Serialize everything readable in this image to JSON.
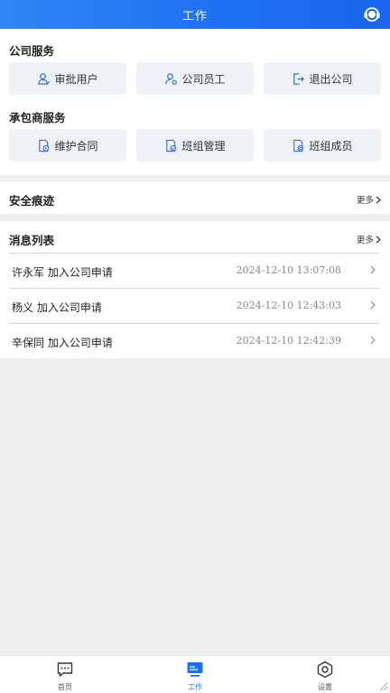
{
  "header": {
    "title": "工作",
    "icon": "headset-icon"
  },
  "company_services": {
    "title": "公司服务",
    "buttons": [
      {
        "label": "审批用户",
        "icon": "user-approve-icon"
      },
      {
        "label": "公司员工",
        "icon": "employee-settings-icon"
      },
      {
        "label": "退出公司",
        "icon": "logout-icon"
      }
    ]
  },
  "contractor_services": {
    "title": "承包商服务",
    "buttons": [
      {
        "label": "维护合同",
        "icon": "contract-doc-icon"
      },
      {
        "label": "班组管理",
        "icon": "doc-check-icon"
      },
      {
        "label": "班组成员",
        "icon": "doc-gear-icon"
      }
    ]
  },
  "safety": {
    "title": "安全痕迹",
    "more_label": "更多"
  },
  "messages": {
    "title": "消息列表",
    "more_label": "更多",
    "items": [
      {
        "text": "许永军 加入公司申请",
        "time": "2024-12-10 13:07:08"
      },
      {
        "text": "杨义 加入公司申请",
        "time": "2024-12-10 12:43:03"
      },
      {
        "text": "辛保同 加入公司申请",
        "time": "2024-12-10 12:42:39"
      }
    ]
  },
  "tabbar": {
    "active": "工作",
    "tabs": [
      {
        "label": "首页",
        "icon": "chat-icon"
      },
      {
        "label": "工作",
        "icon": "monitor-icon"
      },
      {
        "label": "设置",
        "icon": "settings-icon"
      }
    ]
  },
  "colors": {
    "primary": "#1d6ff2",
    "background": "#efefef",
    "button_bg": "#eef1f5"
  }
}
